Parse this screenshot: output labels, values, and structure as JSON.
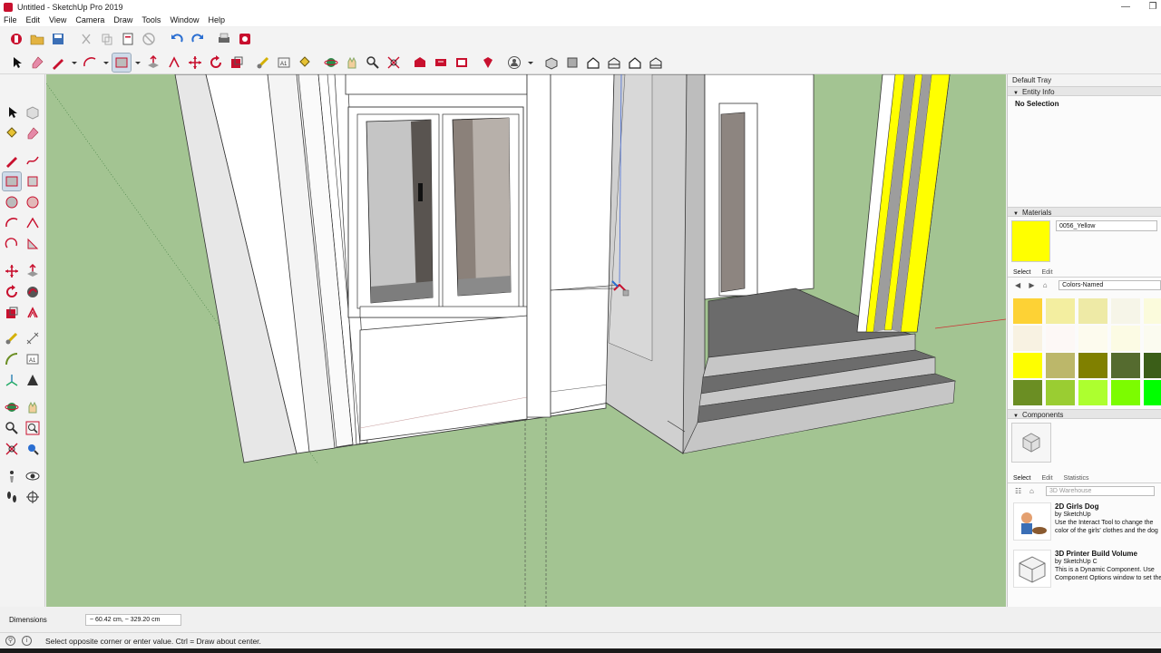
{
  "window": {
    "title": "Untitled - SketchUp Pro 2019",
    "minimize_glyph": "—",
    "restore_glyph": "❐"
  },
  "menu": [
    "File",
    "Edit",
    "View",
    "Camera",
    "Draw",
    "Tools",
    "Window",
    "Help"
  ],
  "tray": {
    "title": "Default Tray",
    "entity_info": {
      "header": "Entity Info",
      "selection": "No Selection"
    },
    "materials": {
      "header": "Materials",
      "current_name": "0056_Yellow",
      "current_color": "#ffff00",
      "tabs": [
        "Select",
        "Edit"
      ],
      "library": "Colors-Named",
      "swatches": [
        "#fdd235",
        "#f3eea0",
        "#eeeaa6",
        "#f6f5e8",
        "#fbfbdc",
        "#f8f2e2",
        "#fdf8f6",
        "#fdfbee",
        "#fcfbe4",
        "#fbfbf0",
        "#fefe00",
        "#bcb76a",
        "#808000",
        "#556b2f",
        "#3b5e18",
        "#6b8e23",
        "#9acd32",
        "#adff2f",
        "#7cfc00",
        "#00ff00"
      ]
    },
    "components": {
      "header": "Components",
      "tabs": [
        "Select",
        "Edit",
        "Statistics"
      ],
      "search_placeholder": "3D Warehouse",
      "items": [
        {
          "name": "2D Girls Dog",
          "author": "by SketchUp",
          "desc1": "Use the Interact Tool to change the",
          "desc2": "color of the girls' clothes and the dog"
        },
        {
          "name": "3D Printer Build Volume",
          "author": "by SketchUp C",
          "desc1": "This is a Dynamic Component. Use",
          "desc2": "Component Options window to set the"
        }
      ]
    }
  },
  "measurements": {
    "label": "Dimensions",
    "value": "~ 60.42 cm, ~ 329.20 cm"
  },
  "status": {
    "hint": "Select opposite corner or enter value. Ctrl = Draw about center."
  },
  "colors": {
    "sky": "#ffffff",
    "ground": "#a3c492",
    "accent_yellow": "#ffff00"
  }
}
